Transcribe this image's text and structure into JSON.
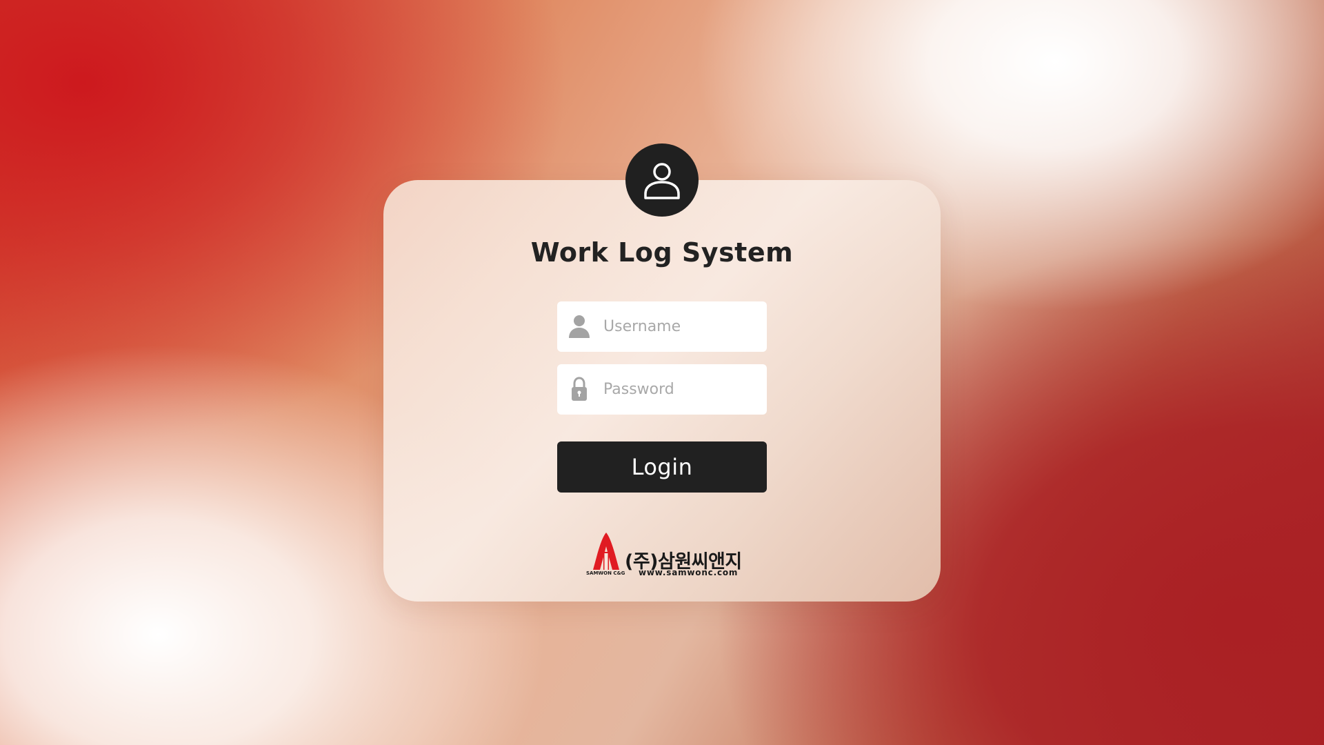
{
  "colors": {
    "accent_dark": "#212121",
    "brand_red": "#e01b22",
    "background_red": "#c81d22",
    "card_tint": "#f6e4da"
  },
  "login": {
    "title": "Work Log System",
    "avatar_icon": "user-outline-icon",
    "username": {
      "placeholder": "Username",
      "value": "",
      "icon": "user-icon"
    },
    "password": {
      "placeholder": "Password",
      "value": "",
      "icon": "lock-icon"
    },
    "submit_label": "Login"
  },
  "footer": {
    "company_name": "(주)삼원씨앤지",
    "company_url": "www.samwonc.com",
    "brand_text": "SAMWON C&G",
    "logo_icon": "samwon-logo-mark"
  }
}
